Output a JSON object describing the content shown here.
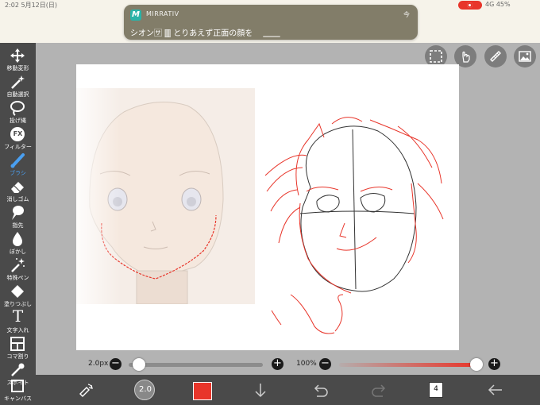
{
  "status_bar": {
    "time": "2:02  5月12日(日)",
    "signal": "4G  45%"
  },
  "notification": {
    "app_name": "MIRRATIV",
    "when": "今",
    "message": "シオン🈂 🀫 とりあえず正面の顔を"
  },
  "tools": [
    {
      "label": "移動変形",
      "icon": "move-icon"
    },
    {
      "label": "自動選択",
      "icon": "magic-wand-icon"
    },
    {
      "label": "投げ縄",
      "icon": "lasso-icon"
    },
    {
      "label": "フィルター",
      "icon": "fx-icon"
    },
    {
      "label": "ブラシ",
      "icon": "brush-icon"
    },
    {
      "label": "消しゴム",
      "icon": "eraser-icon"
    },
    {
      "label": "指先",
      "icon": "smudge-icon"
    },
    {
      "label": "ぼかし",
      "icon": "blur-icon"
    },
    {
      "label": "特殊ペン",
      "icon": "special-pen-icon"
    },
    {
      "label": "塗りつぶし",
      "icon": "fill-icon"
    },
    {
      "label": "文字入れ",
      "icon": "text-icon"
    },
    {
      "label": "コマ割り",
      "icon": "frame-divider-icon"
    },
    {
      "label": "スポイト",
      "icon": "eyedropper-icon"
    },
    {
      "label": "キャンバス",
      "icon": "canvas-icon"
    }
  ],
  "active_tool": "ブラシ",
  "fx_glyph": "FX",
  "text_glyph": "T",
  "brush": {
    "size_label": "2.0px",
    "size_badge": "2.0",
    "opacity_label": "100%",
    "size_value": 0.02,
    "opacity_value": 1.0,
    "minus": "−",
    "plus": "+"
  },
  "colors": {
    "brush": "#e8352a",
    "toolbar": "#4a4a4a",
    "accent": "#4a9ff0"
  },
  "layers": {
    "count": "4"
  }
}
